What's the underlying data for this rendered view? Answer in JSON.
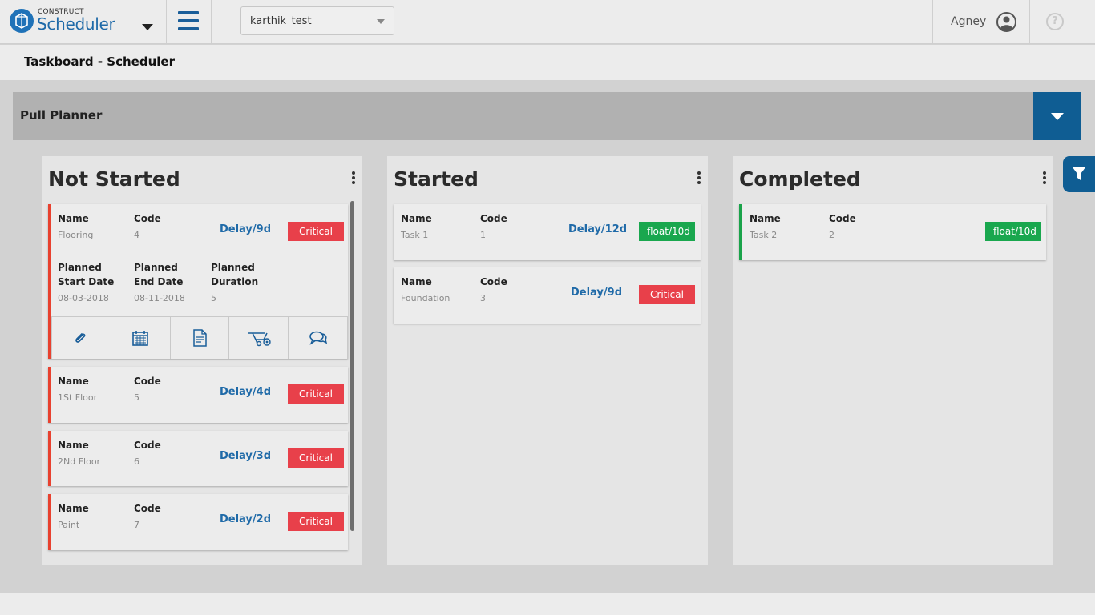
{
  "header": {
    "brand_small": "CONSTRUCT",
    "brand_big": "Scheduler",
    "project": "karthik_test",
    "user": "Agney",
    "help": "?"
  },
  "subheader": {
    "title": "Taskboard - Scheduler"
  },
  "planner": {
    "label": "Pull Planner"
  },
  "labels": {
    "name": "Name",
    "code": "Code",
    "planned_start_1": "Planned",
    "planned_start_2": "Start Date",
    "planned_end_1": "Planned",
    "planned_end_2": "End Date",
    "planned_duration_1": "Planned",
    "planned_duration_2": "Duration"
  },
  "columns": [
    {
      "title": "Not Started",
      "cards": [
        {
          "name": "Flooring",
          "code": "4",
          "delay": "Delay/9d",
          "badge": "Critical",
          "start": "08-03-2018",
          "end": "08-11-2018",
          "duration": "5"
        },
        {
          "name": "1St Floor",
          "code": "5",
          "delay": "Delay/4d",
          "badge": "Critical"
        },
        {
          "name": "2Nd Floor",
          "code": "6",
          "delay": "Delay/3d",
          "badge": "Critical"
        },
        {
          "name": "Paint",
          "code": "7",
          "delay": "Delay/2d",
          "badge": "Critical"
        }
      ]
    },
    {
      "title": "Started",
      "cards": [
        {
          "name": "Task 1",
          "code": "1",
          "delay": "Delay/12d",
          "badge": "float/10d"
        },
        {
          "name": "Foundation",
          "code": "3",
          "delay": "Delay/9d",
          "badge": "Critical"
        }
      ]
    },
    {
      "title": "Completed",
      "cards": [
        {
          "name": "Task 2",
          "code": "2",
          "badge": "float/10d"
        }
      ]
    }
  ],
  "colors": {
    "accent": "#0f5d93",
    "critical": "#e8404a",
    "float": "#19a74e",
    "delay": "#1f6aa8"
  }
}
